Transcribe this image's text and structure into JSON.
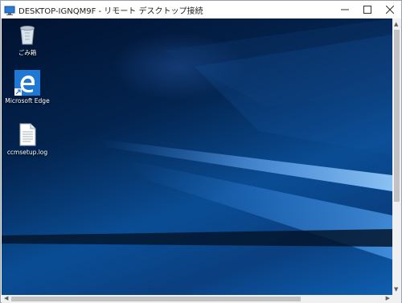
{
  "window": {
    "title": "DESKTOP-IGNQM9F - リモート デスクトップ接続",
    "app_icon": "remote-desktop-icon",
    "controls": {
      "minimize": "minimize-icon",
      "maximize": "maximize-icon",
      "close": "close-icon"
    }
  },
  "desktop": {
    "icons": [
      {
        "label": "ごみ箱",
        "icon": "recycle-bin-icon"
      },
      {
        "label": "Microsoft Edge",
        "icon": "edge-icon"
      },
      {
        "label": "ccmsetup.log",
        "icon": "text-file-icon"
      }
    ]
  },
  "colors": {
    "accent": "#0a4d95",
    "edge_blue": "#1e78d4"
  }
}
